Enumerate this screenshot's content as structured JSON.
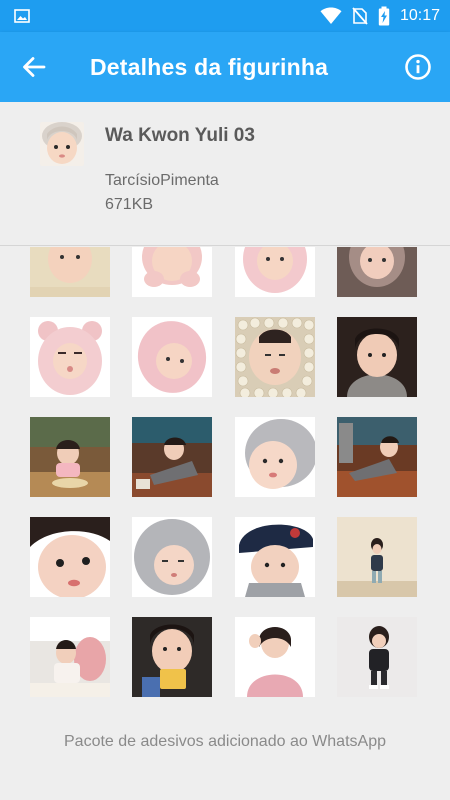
{
  "status_bar": {
    "time": "10:17",
    "icons": [
      "image-icon",
      "wifi-icon",
      "no-sim-icon",
      "battery-charging-icon"
    ],
    "color": "#1e9df0"
  },
  "app_bar": {
    "title": "Detalhes da figurinha",
    "back_icon": "arrow-back-icon",
    "info_icon": "info-icon",
    "color": "#2aa6f5"
  },
  "pack": {
    "name": "Wa Kwon Yuli 03",
    "publisher": "TarcísioPimenta",
    "size": "671KB",
    "tray_icon": "sticker-thumbnail"
  },
  "stickers": [
    {
      "label": "sticker-beige-hood"
    },
    {
      "label": "sticker-pink-face-hands"
    },
    {
      "label": "sticker-pink-hood"
    },
    {
      "label": "sticker-brown-knit"
    },
    {
      "label": "sticker-bear-hood"
    },
    {
      "label": "sticker-pink-hood-tilt"
    },
    {
      "label": "sticker-face-beans"
    },
    {
      "label": "sticker-dark-background"
    },
    {
      "label": "sticker-restaurant-table"
    },
    {
      "label": "sticker-restaurant-yawn"
    },
    {
      "label": "sticker-gray-hood-closeup"
    },
    {
      "label": "sticker-restaurant-stretch"
    },
    {
      "label": "sticker-face-closeup"
    },
    {
      "label": "sticker-gray-hood"
    },
    {
      "label": "sticker-navy-cap"
    },
    {
      "label": "sticker-standing-wall"
    },
    {
      "label": "sticker-pink-chair"
    },
    {
      "label": "sticker-snack-eating"
    },
    {
      "label": "sticker-pink-jacket-pose"
    },
    {
      "label": "sticker-black-jacket"
    }
  ],
  "footer": {
    "message": "Pacote de adesivos adicionado ao WhatsApp"
  }
}
